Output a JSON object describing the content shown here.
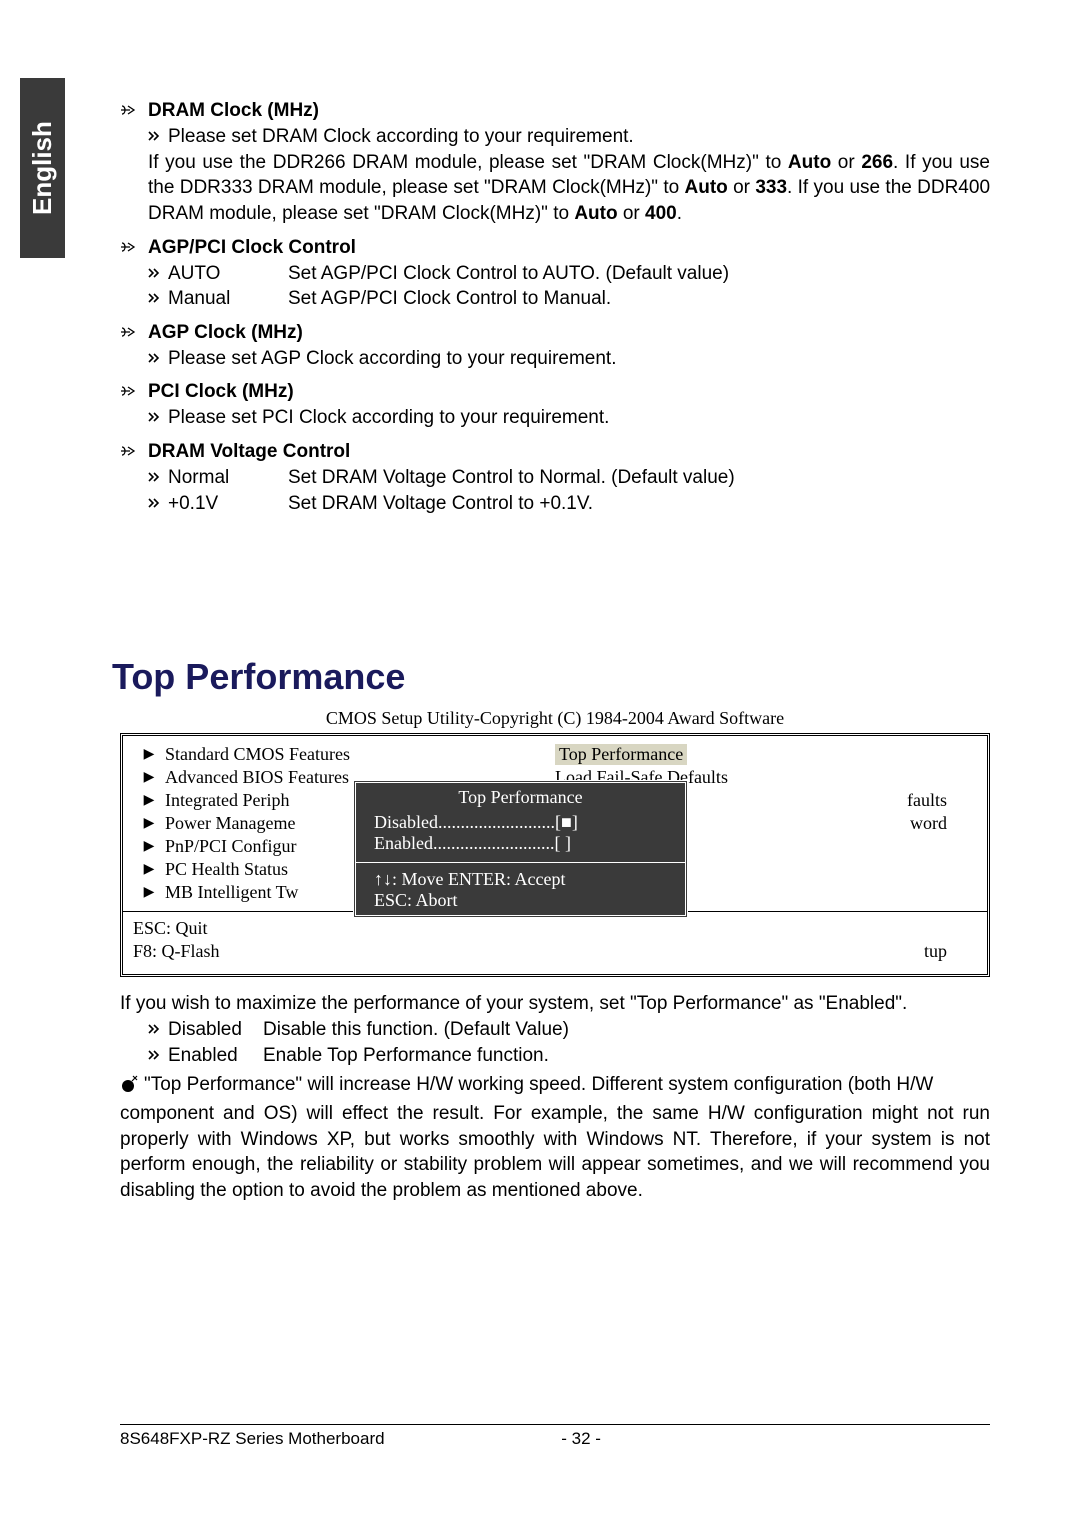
{
  "side_tab": "English",
  "sections": {
    "dram_clock": {
      "title": "DRAM Clock (MHz)",
      "line1": "Please set DRAM Clock according to your requirement.",
      "para_a": "If you use the DDR266 DRAM module, please set \"DRAM Clock(MHz)\" to ",
      "auto1": "Auto",
      "or1": " or ",
      "v266": "266",
      "para_b": ". If you use the DDR333 DRAM module, please set \"DRAM Clock(MHz)\" to ",
      "auto2": "Auto",
      "or2": " or ",
      "v333": "333",
      "para_c": ". If you use the DDR400 DRAM module, please set \"DRAM Clock(MHz)\" to ",
      "auto3": "Auto",
      "or3": " or ",
      "v400": "400",
      "dot": "."
    },
    "agp_pci_ctrl": {
      "title": "AGP/PCI Clock Control",
      "opt1_label": "AUTO",
      "opt1_desc": "Set AGP/PCI Clock Control to AUTO. (Default value)",
      "opt2_label": "Manual",
      "opt2_desc": "Set AGP/PCI Clock Control to Manual."
    },
    "agp_clock": {
      "title": "AGP Clock (MHz)",
      "line1": "Please set AGP Clock according to your requirement."
    },
    "pci_clock": {
      "title": "PCI Clock (MHz)",
      "line1": "Please set PCI Clock according to your requirement."
    },
    "dram_volt": {
      "title": "DRAM Voltage Control",
      "opt1_label": "Normal",
      "opt1_desc": "Set DRAM Voltage Control to Normal. (Default value)",
      "opt2_label": "+0.1V",
      "opt2_desc": "Set DRAM Voltage Control to +0.1V."
    }
  },
  "top_perf_heading": "Top Performance",
  "cmos": {
    "caption": "CMOS Setup Utility-Copyright (C) 1984-2004 Award Software",
    "left": [
      "Standard CMOS Features",
      "Advanced BIOS Features",
      "Integrated Periph",
      "Power Manageme",
      "PnP/PCI Configur",
      "PC Health Status",
      "MB Intelligent Tw"
    ],
    "right_top": "Top Performance",
    "right_load": "Load Fail-Safe Defaults",
    "right_faults": "faults",
    "right_word": "word",
    "bottom_left_1": "ESC: Quit",
    "bottom_left_2": "F8: Q-Flash",
    "bottom_right_tup": "tup",
    "popup": {
      "title": "Top Performance",
      "row1": "Disabled..........................[■]",
      "row2": "Enabled...........................[  ]",
      "keys1": "↑↓: Move          ENTER: Accept",
      "keys2": "ESC: Abort"
    }
  },
  "after": {
    "intro": "If you wish to maximize the performance of your system, set \"Top Performance\" as \"Enabled\".",
    "opt1_label": "Disabled",
    "opt1_desc": "Disable this function. (Default Value)",
    "opt2_label": "Enabled",
    "opt2_desc": "Enable Top Performance function.",
    "bomb_prefix": "\"Top Performance\" will increase H/W working speed. Different system configuration (both H/W ",
    "bomb_rest": "component and OS) will effect the result. For example, the same H/W configuration might not run properly with Windows XP, but works smoothly with Windows NT. Therefore, if your system is not perform enough, the reliability or stability problem will appear sometimes, and we will recommend you disabling the option to avoid the problem as mentioned above."
  },
  "footer": {
    "left": "8S648FXP-RZ Series Motherboard",
    "page": "- 32 -"
  }
}
